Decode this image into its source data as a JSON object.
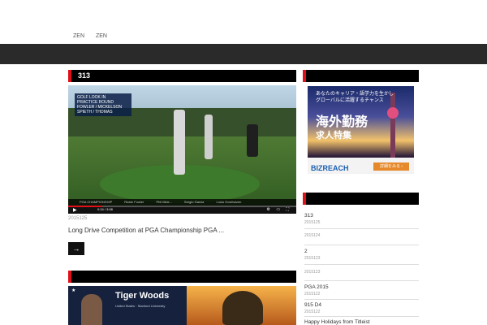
{
  "topnav": [
    "ZEN",
    "ZEN"
  ],
  "main": {
    "section1_title": "313",
    "video": {
      "overlay": [
        "GOLF LOOK IN",
        "PRACTICE ROUND",
        "FOWLER / MICKELSON",
        "SPIETH / THOMAS"
      ],
      "lower_third": [
        "PGA CHAMPIONSHIP",
        "Rickie Fowler",
        "Phil Mick...",
        "Sergio Garcia",
        "Louis Oosthuizen"
      ],
      "time": "0:24 / 3:08",
      "progress": 0.15
    },
    "date": "2015125",
    "post_title": "Long Drive Competition at PGA Championship PGA ...",
    "more_label": "→",
    "section2_title": "",
    "thumb2": {
      "name": "Tiger Woods",
      "tag": "United States · Stanford University"
    }
  },
  "sidebar": {
    "ad": {
      "copy": "あなたのキャリア・語学力を生かし グローバルに活躍するチャンス",
      "big": "海外勤務",
      "mid": "求人特集",
      "brand": "BIZREACH",
      "cta": "詳細をみる ›"
    },
    "items": [
      {
        "title": "313",
        "date": "2015125"
      },
      {
        "title": "",
        "date": "2015124"
      },
      {
        "title": "2",
        "date": "2015123"
      },
      {
        "title": "",
        "date": "2015123"
      },
      {
        "title": "PGA  2015",
        "date": "2015122"
      },
      {
        "title": "915 D4",
        "date": "2015122"
      },
      {
        "title": "Happy Holidays from Titleist",
        "date": ""
      }
    ]
  },
  "colors": {
    "accent": "#e0101a",
    "bar": "#2a2a2a",
    "head": "#000000"
  }
}
